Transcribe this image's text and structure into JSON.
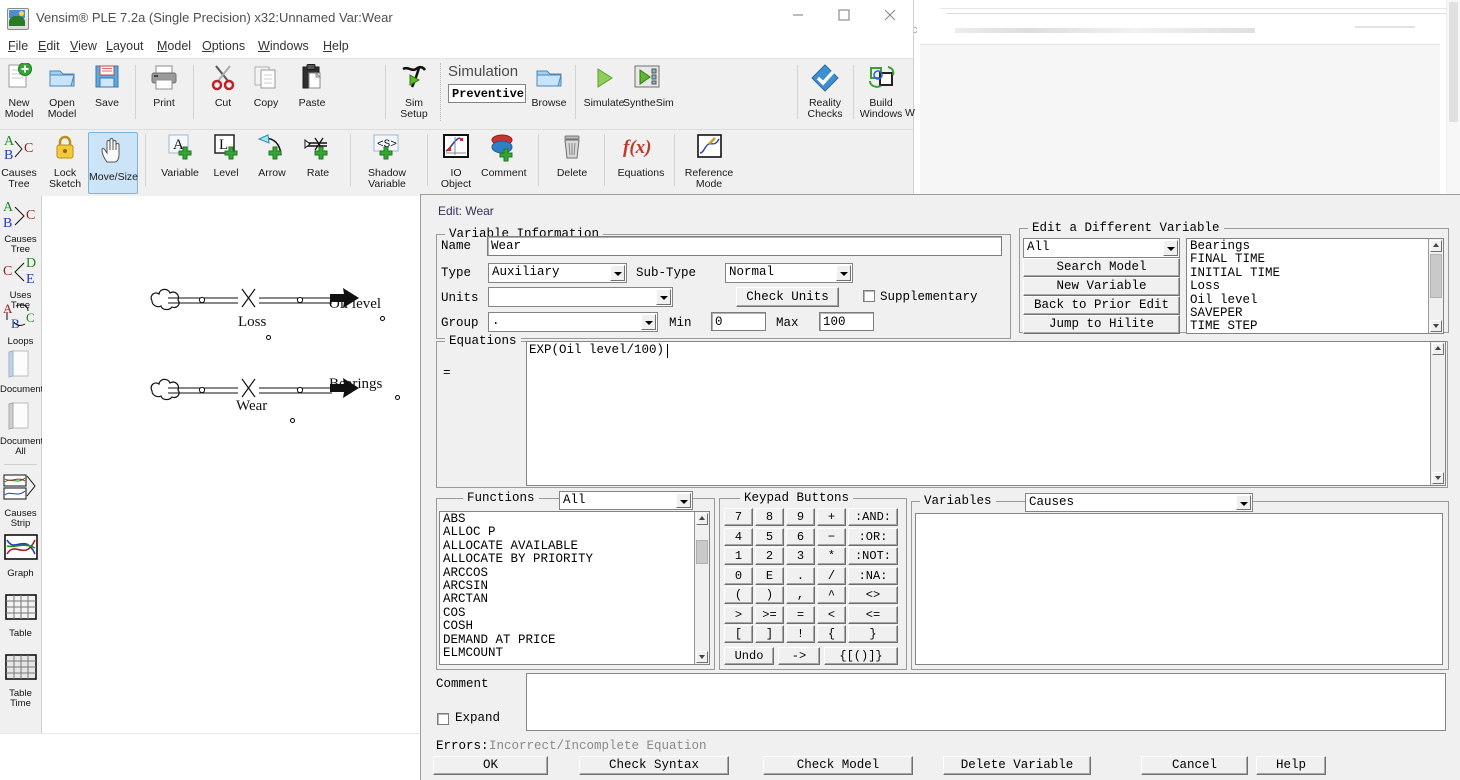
{
  "window": {
    "title": "Vensim® PLE 7.2a (Single Precision) x32:Unnamed Var:Wear",
    "app_icon": "vensim-logo-icon",
    "controls": {
      "minimize": "minimize-icon",
      "maximize": "maximize-icon",
      "close": "close-icon"
    }
  },
  "menu": [
    {
      "label": "File"
    },
    {
      "label": "Edit"
    },
    {
      "label": "View"
    },
    {
      "label": "Layout"
    },
    {
      "label": "Model"
    },
    {
      "label": "Options"
    },
    {
      "label": "Windows"
    },
    {
      "label": "Help"
    }
  ],
  "toolbar_main": [
    {
      "label": "New\nModel",
      "icon": "new-model-icon"
    },
    {
      "label": "Open\nModel",
      "icon": "open-model-icon"
    },
    {
      "label": "Save",
      "icon": "save-icon"
    },
    {
      "label": "Print",
      "icon": "print-icon"
    },
    {
      "label": "Cut",
      "icon": "cut-icon"
    },
    {
      "label": "Copy",
      "icon": "copy-icon"
    },
    {
      "label": "Paste",
      "icon": "paste-icon"
    },
    {
      "label": "Sim Setup",
      "icon": "sim-setup-icon"
    },
    {
      "label": "Browse",
      "icon": "browse-folder-icon"
    },
    {
      "label": "Simulate",
      "icon": "simulate-play-icon"
    },
    {
      "label": "SyntheSim",
      "icon": "synthesim-icon"
    },
    {
      "label": "Reality\nChecks",
      "icon": "reality-checks-icon"
    },
    {
      "label": "Build\nWindows",
      "icon": "build-windows-icon"
    }
  ],
  "simulation": {
    "group_label": "Simulation",
    "run_name": "Preventive "
  },
  "toolbar_sketch": [
    {
      "label": "Causes\nTree",
      "icon": "causes-tree-icon"
    },
    {
      "label": "Lock\nSketch",
      "icon": "lock-sketch-icon"
    },
    {
      "label": "Move/Size",
      "icon": "move-size-hand-icon",
      "selected": true
    },
    {
      "label": "Variable",
      "icon": "add-variable-icon"
    },
    {
      "label": "Level",
      "icon": "add-level-icon"
    },
    {
      "label": "Arrow",
      "icon": "add-arrow-icon"
    },
    {
      "label": "Rate",
      "icon": "add-rate-icon"
    },
    {
      "label": "Shadow\nVariable",
      "icon": "shadow-variable-icon"
    },
    {
      "label": "IO Object",
      "icon": "io-object-icon"
    },
    {
      "label": "Comment",
      "icon": "add-comment-icon"
    },
    {
      "label": "Delete",
      "icon": "delete-trash-icon"
    },
    {
      "label": "Equations",
      "icon": "equations-fx-icon"
    },
    {
      "label": "Reference\nMode",
      "icon": "reference-mode-icon"
    }
  ],
  "toolstrip": [
    {
      "label": "Causes\nTree",
      "icon": "causes-tree-icon"
    },
    {
      "label": "Uses Tree",
      "icon": "uses-tree-icon"
    },
    {
      "label": "Loops",
      "icon": "loops-icon"
    },
    {
      "label": "Document",
      "icon": "document-icon"
    },
    {
      "label": "Document\nAll",
      "icon": "document-all-icon"
    },
    {
      "label": "Causes\nStrip",
      "icon": "causes-strip-icon"
    },
    {
      "label": "Graph",
      "icon": "graph-icon"
    },
    {
      "label": "Table",
      "icon": "table-icon"
    },
    {
      "label": "Table\nTime",
      "icon": "table-time-icon"
    }
  ],
  "sketch": {
    "flows": [
      {
        "rate": "Loss",
        "stock": "Oil level"
      },
      {
        "rate": "Wear",
        "stock": "Bearings"
      }
    ]
  },
  "dialog": {
    "title": "Edit: Wear",
    "variable_information": {
      "legend": "Variable Information",
      "name_label": "Name",
      "name_value": "Wear",
      "type_label": "Type",
      "type_value": "Auxiliary",
      "subtype_label": "Sub-Type",
      "subtype_value": "Normal",
      "units_label": "Units",
      "units_value": "",
      "check_units_label": "Check Units",
      "supplementary_label": "Supplementary",
      "supplementary_checked": false,
      "group_label": "Group",
      "group_value": ".",
      "min_label": "Min",
      "min_value": "0",
      "max_label": "Max",
      "max_value": "100"
    },
    "edit_different_variable": {
      "legend": "Edit a Different Variable",
      "filter_value": "All",
      "buttons": [
        {
          "label": "Search Model"
        },
        {
          "label": "New Variable"
        },
        {
          "label": "Back to Prior Edit"
        },
        {
          "label": "Jump to Hilite"
        }
      ],
      "variables": [
        "Bearings",
        "FINAL TIME",
        "INITIAL TIME",
        "Loss",
        "Oil level",
        "SAVEPER",
        "TIME STEP"
      ]
    },
    "equations": {
      "legend": "Equations",
      "equals_sign": "=",
      "value": "EXP(Oil level/100)"
    },
    "functions": {
      "legend": "Functions",
      "filter_value": "All",
      "items": [
        "ABS",
        "ALLOC P",
        "ALLOCATE AVAILABLE",
        "ALLOCATE BY PRIORITY",
        "ARCCOS",
        "ARCSIN",
        "ARCTAN",
        "COS",
        "COSH",
        "DEMAND AT PRICE",
        "ELMCOUNT"
      ]
    },
    "keypad": {
      "legend": "Keypad Buttons",
      "rows": [
        [
          "7",
          "8",
          "9",
          "+",
          ":AND:"
        ],
        [
          "4",
          "5",
          "6",
          "−",
          ":OR:"
        ],
        [
          "1",
          "2",
          "3",
          "*",
          ":NOT:"
        ],
        [
          "0",
          "E",
          ".",
          "/",
          ":NA:"
        ],
        [
          "(",
          ")",
          ",",
          "^",
          "<>"
        ],
        [
          ">",
          ">=",
          "=",
          "<",
          "<="
        ],
        [
          "[",
          "]",
          "!",
          "{",
          "}"
        ]
      ],
      "bottom_row": [
        "Undo",
        "->",
        "{[()]}"
      ]
    },
    "variables_panel": {
      "legend": "Variables",
      "filter_value": "Causes",
      "items": []
    },
    "comment": {
      "label": "Comment",
      "value": "",
      "expand_label": "Expand",
      "expand_checked": false
    },
    "errors": {
      "label": "Errors:",
      "value": "Incorrect/Incomplete Equation"
    },
    "actions": [
      {
        "label": "OK"
      },
      {
        "label": "Check Syntax"
      },
      {
        "label": "Check Model"
      },
      {
        "label": "Delete Variable"
      },
      {
        "label": "Cancel"
      },
      {
        "label": "Help"
      }
    ]
  }
}
